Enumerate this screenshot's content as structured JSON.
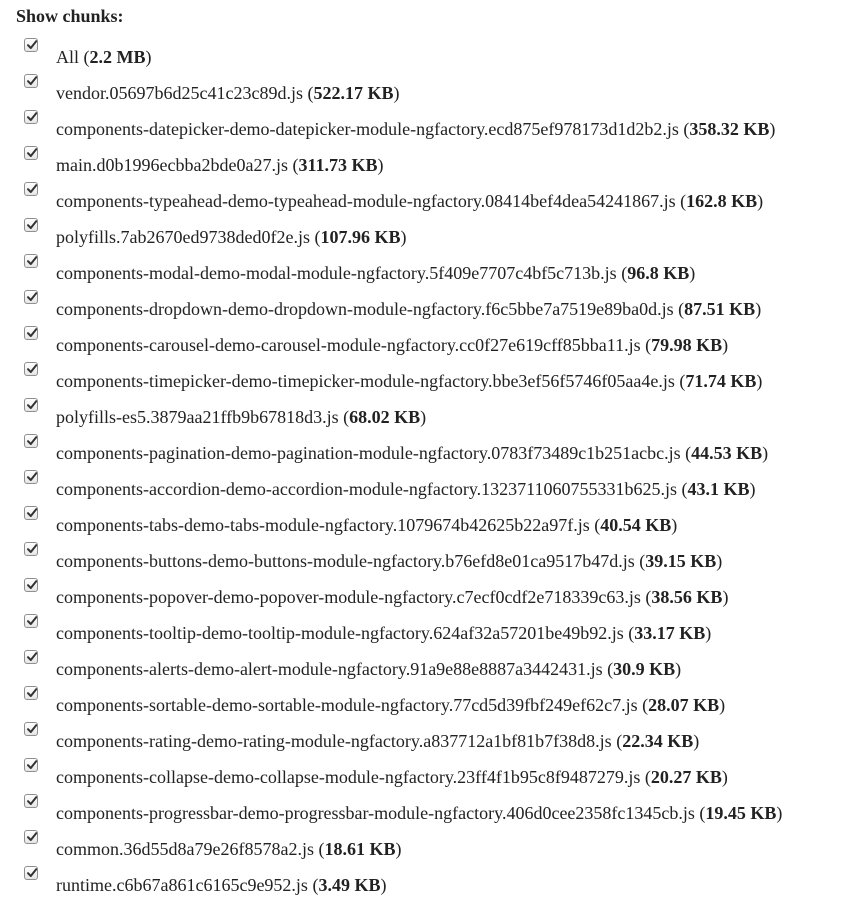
{
  "heading": "Show chunks:",
  "items": [
    {
      "name": "All",
      "size": "2.2 MB",
      "checked": true
    },
    {
      "name": "vendor.05697b6d25c41c23c89d.js",
      "size": "522.17 KB",
      "checked": true
    },
    {
      "name": "components-datepicker-demo-datepicker-module-ngfactory.ecd875ef978173d1d2b2.js",
      "size": "358.32 KB",
      "checked": true
    },
    {
      "name": "main.d0b1996ecbba2bde0a27.js",
      "size": "311.73 KB",
      "checked": true
    },
    {
      "name": "components-typeahead-demo-typeahead-module-ngfactory.08414bef4dea54241867.js",
      "size": "162.8 KB",
      "checked": true
    },
    {
      "name": "polyfills.7ab2670ed9738ded0f2e.js",
      "size": "107.96 KB",
      "checked": true
    },
    {
      "name": "components-modal-demo-modal-module-ngfactory.5f409e7707c4bf5c713b.js",
      "size": "96.8 KB",
      "checked": true
    },
    {
      "name": "components-dropdown-demo-dropdown-module-ngfactory.f6c5bbe7a7519e89ba0d.js",
      "size": "87.51 KB",
      "checked": true
    },
    {
      "name": "components-carousel-demo-carousel-module-ngfactory.cc0f27e619cff85bba11.js",
      "size": "79.98 KB",
      "checked": true
    },
    {
      "name": "components-timepicker-demo-timepicker-module-ngfactory.bbe3ef56f5746f05aa4e.js",
      "size": "71.74 KB",
      "checked": true
    },
    {
      "name": "polyfills-es5.3879aa21ffb9b67818d3.js",
      "size": "68.02 KB",
      "checked": true
    },
    {
      "name": "components-pagination-demo-pagination-module-ngfactory.0783f73489c1b251acbc.js",
      "size": "44.53 KB",
      "checked": true
    },
    {
      "name": "components-accordion-demo-accordion-module-ngfactory.1323711060755331b625.js",
      "size": "43.1 KB",
      "checked": true
    },
    {
      "name": "components-tabs-demo-tabs-module-ngfactory.1079674b42625b22a97f.js",
      "size": "40.54 KB",
      "checked": true
    },
    {
      "name": "components-buttons-demo-buttons-module-ngfactory.b76efd8e01ca9517b47d.js",
      "size": "39.15 KB",
      "checked": true
    },
    {
      "name": "components-popover-demo-popover-module-ngfactory.c7ecf0cdf2e718339c63.js",
      "size": "38.56 KB",
      "checked": true
    },
    {
      "name": "components-tooltip-demo-tooltip-module-ngfactory.624af32a57201be49b92.js",
      "size": "33.17 KB",
      "checked": true
    },
    {
      "name": "components-alerts-demo-alert-module-ngfactory.91a9e88e8887a3442431.js",
      "size": "30.9 KB",
      "checked": true
    },
    {
      "name": "components-sortable-demo-sortable-module-ngfactory.77cd5d39fbf249ef62c7.js",
      "size": "28.07 KB",
      "checked": true
    },
    {
      "name": "components-rating-demo-rating-module-ngfactory.a837712a1bf81b7f38d8.js",
      "size": "22.34 KB",
      "checked": true
    },
    {
      "name": "components-collapse-demo-collapse-module-ngfactory.23ff4f1b95c8f9487279.js",
      "size": "20.27 KB",
      "checked": true
    },
    {
      "name": "components-progressbar-demo-progressbar-module-ngfactory.406d0cee2358fc1345cb.js",
      "size": "19.45 KB",
      "checked": true
    },
    {
      "name": "common.36d55d8a79e26f8578a2.js",
      "size": "18.61 KB",
      "checked": true
    },
    {
      "name": "runtime.c6b67a861c6165c9e952.js",
      "size": "3.49 KB",
      "checked": true
    }
  ],
  "colors": {
    "text": "#222222",
    "checkmark": "#333333",
    "checkbox_border": "#8f8f8f"
  },
  "icons": {
    "checkbox": "checkmark-icon"
  }
}
